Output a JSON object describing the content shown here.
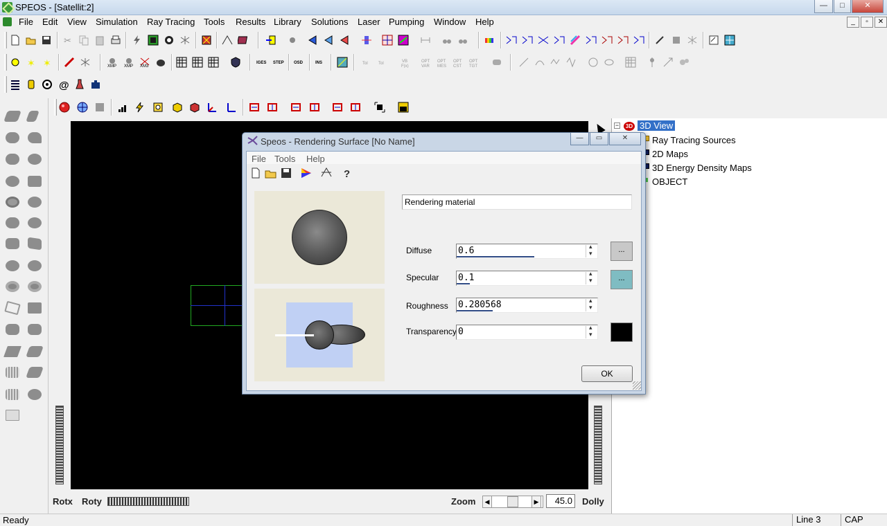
{
  "window": {
    "title": "SPEOS - [Satellit:2]",
    "minimize_label": "—",
    "maximize_label": "□",
    "close_label": "✕"
  },
  "menubar": {
    "items": [
      {
        "label": "File"
      },
      {
        "label": "Edit"
      },
      {
        "label": "View"
      },
      {
        "label": "Simulation"
      },
      {
        "label": "Ray Tracing"
      },
      {
        "label": "Tools"
      },
      {
        "label": "Results"
      },
      {
        "label": "Library"
      },
      {
        "label": "Solutions"
      },
      {
        "label": "Laser"
      },
      {
        "label": "Pumping"
      },
      {
        "label": "Window"
      },
      {
        "label": "Help"
      }
    ]
  },
  "viewport": {
    "bottom": {
      "rotx_label": "Rotx",
      "roty_label": "Roty",
      "zoom_label": "Zoom",
      "zoom_value": "45.0",
      "dolly_label": "Dolly",
      "left_arrow": "◀",
      "right_arrow": "▶"
    }
  },
  "tree": {
    "root_label": "3D View",
    "expander": "−",
    "items": [
      {
        "label": "Ray Tracing Sources"
      },
      {
        "label": "2D Maps"
      },
      {
        "label": "3D Energy Density Maps"
      },
      {
        "label": "OBJECT"
      }
    ]
  },
  "statusbar": {
    "message": "Ready",
    "line": "Line 3",
    "caps": "CAP"
  },
  "dialog": {
    "title": "Speos - Rendering Surface [No Name]",
    "menu": [
      "File",
      "Tools",
      "Help"
    ],
    "material_name": "Rendering material",
    "fields": [
      {
        "label": "Diffuse",
        "value": "0.6",
        "fill": 0.6
      },
      {
        "label": "Specular",
        "value": "0.1",
        "fill": 0.1
      },
      {
        "label": "Roughness",
        "value": "0.280568",
        "fill": 0.28
      },
      {
        "label": "Transparency",
        "value": "0",
        "fill": 0
      }
    ],
    "diffuse_color": "#c8c8c8",
    "specular_color": "#7fbcc2",
    "transparency_color": "#000000",
    "swatch_button_label": "...",
    "ok_label": "OK"
  }
}
